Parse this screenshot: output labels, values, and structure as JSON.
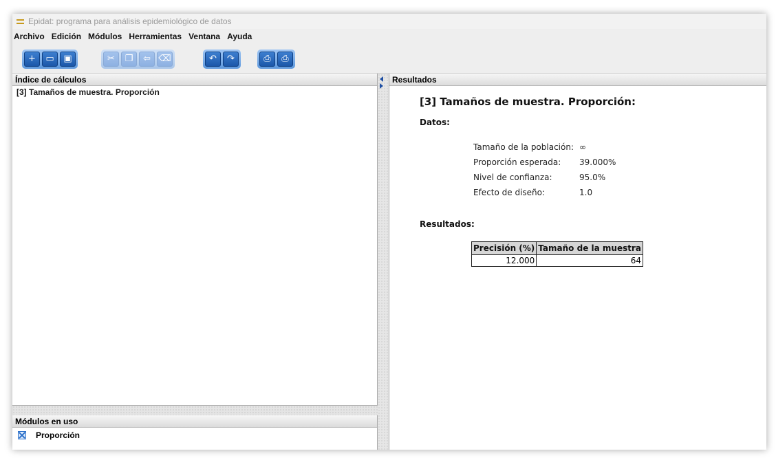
{
  "window": {
    "title": "Epidat: programa para análisis epidemiológico de datos"
  },
  "menu": [
    "Archivo",
    "Edición",
    "Módulos",
    "Herramientas",
    "Ventana",
    "Ayuda"
  ],
  "toolbar": {
    "groups": [
      {
        "enabled": true,
        "buttons": [
          {
            "icon": "new-file-icon",
            "glyph": "+"
          },
          {
            "icon": "open-folder-icon",
            "glyph": "▭"
          },
          {
            "icon": "save-icon",
            "glyph": "▣"
          }
        ]
      },
      {
        "enabled": false,
        "buttons": [
          {
            "icon": "cut-icon",
            "glyph": "✂"
          },
          {
            "icon": "copy-icon",
            "glyph": "❐"
          },
          {
            "icon": "paste-icon",
            "glyph": "⇦"
          },
          {
            "icon": "eraser-icon",
            "glyph": "⌫"
          }
        ]
      },
      {
        "enabled": true,
        "buttons": [
          {
            "icon": "undo-icon",
            "glyph": "↶"
          },
          {
            "icon": "redo-icon",
            "glyph": "↷"
          }
        ]
      },
      {
        "enabled": true,
        "buttons": [
          {
            "icon": "print-preview-icon",
            "glyph": "⎙"
          },
          {
            "icon": "print-icon",
            "glyph": "⎙"
          }
        ]
      }
    ]
  },
  "index_panel": {
    "header": "Índice de cálculos",
    "items": [
      "[3] Tamaños de muestra. Proporción"
    ]
  },
  "modules_panel": {
    "header": "Módulos en uso",
    "items": [
      "Proporción"
    ]
  },
  "results_panel": {
    "header": "Resultados",
    "title": "[3] Tamaños de muestra. Proporción:",
    "data_heading": "Datos:",
    "params": [
      {
        "label": "Tamaño de la población:",
        "value": "∞"
      },
      {
        "label": "Proporción esperada:",
        "value": "39.000%"
      },
      {
        "label": "Nivel de confianza:",
        "value": "95.0%"
      },
      {
        "label": "Efecto de diseño:",
        "value": "1.0"
      }
    ],
    "results_heading": "Resultados:",
    "table": {
      "headers": [
        "Precisión (%)",
        "Tamaño de la muestra"
      ],
      "rows": [
        [
          "12.000",
          "64"
        ]
      ]
    }
  },
  "colors": {
    "toolbar_button": "#1c58aa",
    "toolbar_group": "#5d98dd",
    "header_bg": "#dcdcdc"
  }
}
